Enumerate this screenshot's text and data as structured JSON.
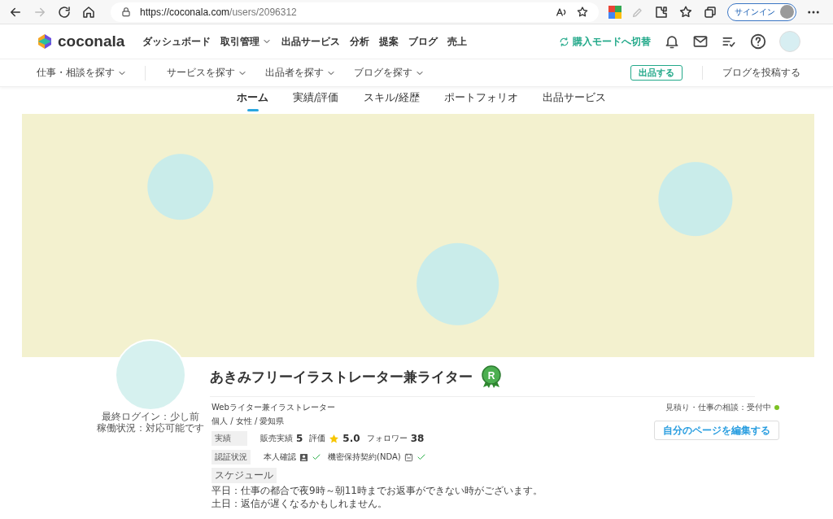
{
  "browser": {
    "url_host": "https://coconala.com",
    "url_path": "/users/2096312",
    "signin": "サインイン"
  },
  "header": {
    "logo": "coconala",
    "nav": [
      {
        "label": "ダッシュボード",
        "dropdown": false
      },
      {
        "label": "取引管理",
        "dropdown": true
      },
      {
        "label": "出品サービス",
        "dropdown": false
      },
      {
        "label": "分析",
        "dropdown": false
      },
      {
        "label": "提案",
        "dropdown": false
      },
      {
        "label": "ブログ",
        "dropdown": false
      },
      {
        "label": "売上",
        "dropdown": false
      }
    ],
    "switch_mode": "購入モードへ切替"
  },
  "subnav": {
    "items": [
      {
        "label": "仕事・相談を探す",
        "dropdown": true
      },
      {
        "label": "サービスを探す",
        "dropdown": true
      },
      {
        "label": "出品者を探す",
        "dropdown": true
      },
      {
        "label": "ブログを探す",
        "dropdown": true
      }
    ],
    "sell_button": "出品する",
    "blog_post": "ブログを投稿する"
  },
  "tabs": [
    {
      "label": "ホーム",
      "selected": true
    },
    {
      "label": "実績/評価",
      "selected": false
    },
    {
      "label": "スキル/経歴",
      "selected": false
    },
    {
      "label": "ポートフォリオ",
      "selected": false
    },
    {
      "label": "出品サービス",
      "selected": false
    }
  ],
  "profile": {
    "name": "あきみフリーイラストレーター兼ライター",
    "badge": "R",
    "last_login": "最終ログイン：少し前",
    "work_status": "稼働状況：対応可能です",
    "tagline": "Webライター兼イラストレーター",
    "attributes": "個人 / 女性 / 愛知県",
    "record_label": "実績",
    "stats": [
      {
        "label": "販売実績",
        "value": "5",
        "kind": "count"
      },
      {
        "label": "評価",
        "value": "5.0",
        "kind": "rating"
      },
      {
        "label": "フォロワー",
        "value": "38",
        "kind": "count"
      }
    ],
    "verification_label": "認証状況",
    "verifications": [
      {
        "label": "本人確認",
        "kind": "id",
        "verified": true
      },
      {
        "label": "機密保持契約(NDA)",
        "kind": "nda",
        "verified": true
      }
    ],
    "schedule_label": "スケジュール",
    "schedule": [
      "平日：仕事の都合で夜9時～朝11時までお返事ができない時がございます。",
      "土日：返信が遅くなるかもしれません。"
    ],
    "consult_status": "見積り・仕事の相談：受付中",
    "accepting": true,
    "edit_button": "自分のページを編集する"
  }
}
